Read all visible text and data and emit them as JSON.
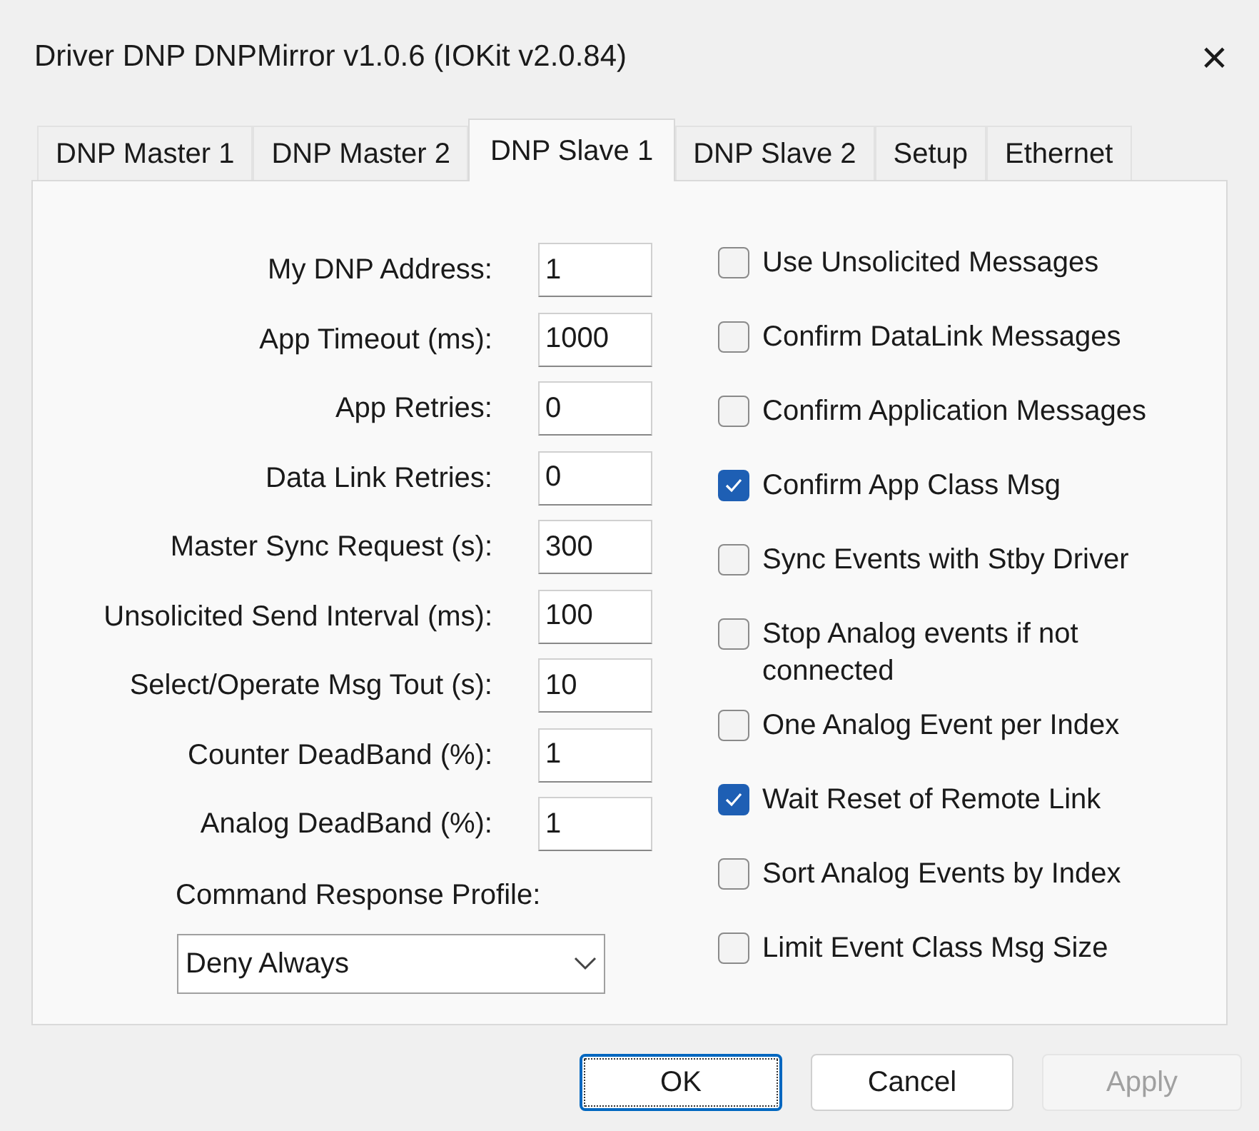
{
  "window": {
    "title": "Driver DNP DNPMirror v1.0.6 (IOKit v2.0.84)",
    "close": "×"
  },
  "tabs": [
    {
      "label": "DNP Master 1",
      "selected": false
    },
    {
      "label": "DNP Master 2",
      "selected": false
    },
    {
      "label": "DNP Slave 1",
      "selected": true
    },
    {
      "label": "DNP Slave 2",
      "selected": false
    },
    {
      "label": "Setup",
      "selected": false
    },
    {
      "label": "Ethernet",
      "selected": false
    }
  ],
  "fields": [
    {
      "label": "My DNP Address:",
      "value": "1"
    },
    {
      "label": "App Timeout (ms):",
      "value": "1000"
    },
    {
      "label": "App Retries:",
      "value": "0"
    },
    {
      "label": "Data Link Retries:",
      "value": "0"
    },
    {
      "label": "Master Sync Request (s):",
      "value": "300"
    },
    {
      "label": "Unsolicited Send Interval (ms):",
      "value": "100"
    },
    {
      "label": "Select/Operate Msg Tout (s):",
      "value": "10"
    },
    {
      "label": "Counter DeadBand (%):",
      "value": "1"
    },
    {
      "label": "Analog DeadBand (%):",
      "value": "1"
    }
  ],
  "profile": {
    "label": "Command Response Profile:",
    "value": "Deny Always"
  },
  "options": [
    {
      "label": "Use Unsolicited Messages",
      "checked": false
    },
    {
      "label": "Confirm DataLink Messages",
      "checked": false
    },
    {
      "label": "Confirm Application Messages",
      "checked": false
    },
    {
      "label": "Confirm App Class Msg",
      "checked": true
    },
    {
      "label": "Sync Events with Stby Driver",
      "checked": false
    },
    {
      "label": "Stop Analog events if not connected",
      "checked": false
    },
    {
      "label": "One Analog Event per Index",
      "checked": false
    },
    {
      "label": "Wait Reset of Remote Link",
      "checked": true
    },
    {
      "label": "Sort Analog Events by Index",
      "checked": false
    },
    {
      "label": "Limit Event Class Msg Size",
      "checked": false
    }
  ],
  "buttons": [
    {
      "label": "OK",
      "disabled": false
    },
    {
      "label": "Cancel",
      "disabled": false
    },
    {
      "label": "Apply",
      "disabled": true
    }
  ]
}
